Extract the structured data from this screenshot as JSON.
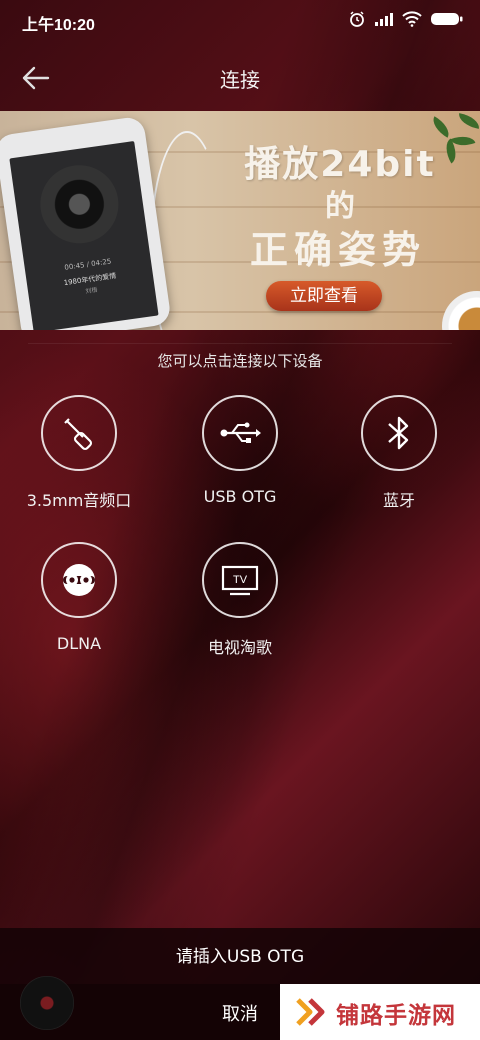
{
  "status_bar": {
    "time": "上午10:20",
    "battery": "battery-icon",
    "wifi": "wifi-icon",
    "signal": "signal-icon",
    "alarm": "alarm-icon"
  },
  "header": {
    "title": "连接"
  },
  "banner": {
    "line1": "播放24bit",
    "line2": "的",
    "line3": "正确姿势",
    "button": "立即查看",
    "phone": {
      "time": "00:45 / 04:25",
      "song": "1980年代的爱情",
      "artist": "刘梧"
    }
  },
  "intro": "您可以点击连接以下设备",
  "devices": [
    {
      "label": "3.5mm音频口",
      "icon": "headphone-jack-icon"
    },
    {
      "label": "USB OTG",
      "icon": "usb-icon"
    },
    {
      "label": "蓝牙",
      "icon": "bluetooth-icon"
    },
    {
      "label": "DLNA",
      "icon": "dlna-icon"
    },
    {
      "label": "电视淘歌",
      "icon": "tv-icon"
    }
  ],
  "bottom": {
    "message": "请插入USB OTG",
    "cancel": "取消"
  },
  "watermark": {
    "text": "铺路手游网"
  },
  "colors": {
    "bg": "#3a0a10",
    "accent": "#c4363b",
    "button": "#d75a2a"
  }
}
